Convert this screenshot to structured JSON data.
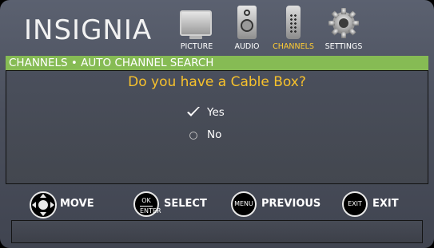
{
  "brand": {
    "logo_text": "INSIGNIA"
  },
  "menu_tabs": [
    {
      "label": "PICTURE",
      "icon": "tv-icon",
      "active": false
    },
    {
      "label": "AUDIO",
      "icon": "speaker-icon",
      "active": false
    },
    {
      "label": "CHANNELS",
      "icon": "remote-icon",
      "active": true
    },
    {
      "label": "SETTINGS",
      "icon": "gear-icon",
      "active": false
    }
  ],
  "breadcrumb": "CHANNELS • AUTO CHANNEL SEARCH",
  "dialog": {
    "question": "Do you have a Cable Box?",
    "options": [
      {
        "label": "Yes",
        "selected": true,
        "mark_icon": "checkmark-icon"
      },
      {
        "label": "No",
        "selected": false,
        "mark_icon": "radio-icon"
      }
    ]
  },
  "footer": {
    "hints": [
      {
        "button": "",
        "button_icon": "dpad-icon",
        "label": "MOVE"
      },
      {
        "button": "OK",
        "button_line2": "ENTER",
        "button_icon": "ok-enter-button-icon",
        "label": "SELECT"
      },
      {
        "button": "MENU",
        "button_icon": "menu-button-icon",
        "label": "PREVIOUS"
      },
      {
        "button": "EXIT",
        "button_icon": "exit-button-icon",
        "label": "EXIT"
      }
    ]
  },
  "colors": {
    "accent_band": "#86bb54",
    "question_text": "#f7c12c",
    "active_tab_label": "#ffcc33"
  }
}
